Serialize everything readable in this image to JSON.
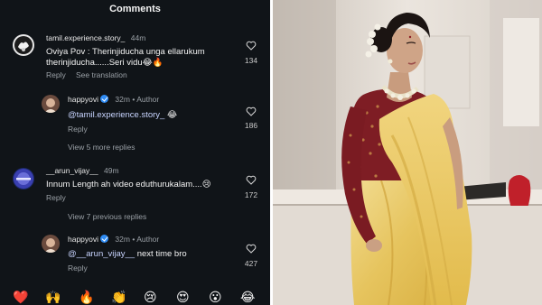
{
  "header": {
    "title": "Comments"
  },
  "comments": [
    {
      "username": "tamil.experience.story_",
      "time": "44m",
      "line1": "Oviya Pov : Therinjiducha unga ellarukum",
      "line2": "therinjiducha......Seri vidu😂🔥",
      "reply": "Reply",
      "translate": "See translation",
      "likes": "134"
    },
    {
      "username": "happyovi",
      "time": "32m",
      "author": "• Author",
      "mention": "@tamil.experience.story_",
      "text": " 😂",
      "reply": "Reply",
      "likes": "186"
    },
    {
      "view_more": "View 5 more replies"
    },
    {
      "username": "__arun_vijay__",
      "time": "49m",
      "text": "Innum Length ah video eduthurukalam....😢",
      "reply": "Reply",
      "likes": "172"
    },
    {
      "view_previous": "View 7 previous replies"
    },
    {
      "username": "happyovi",
      "time": "32m",
      "author": "• Author",
      "mention": "@__arun_vijay__",
      "text": " next time bro",
      "reply": "Reply",
      "likes": "427"
    }
  ],
  "emoji_bar": [
    "❤️",
    "🙌",
    "🔥",
    "👏",
    "😢",
    "😍",
    "😮",
    "😂"
  ],
  "icons": {
    "like": "heart-outline-icon",
    "verified": "verified-badge-icon"
  },
  "colors": {
    "panel_bg": "#101418",
    "verified": "#2f8cf5",
    "mention": "#c8d4ff"
  }
}
